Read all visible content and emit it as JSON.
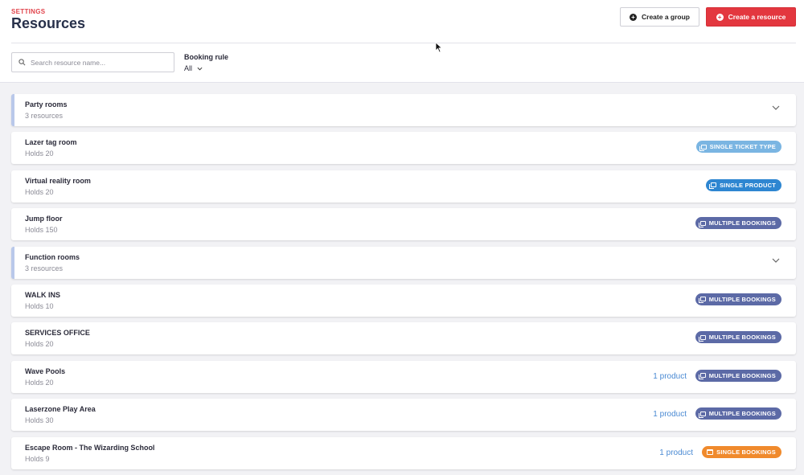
{
  "header": {
    "section_label": "SETTINGS",
    "title": "Resources",
    "create_group_label": "Create a group",
    "create_resource_label": "Create a resource"
  },
  "filters": {
    "search_placeholder": "Search resource name...",
    "search_value": "",
    "booking_rule_label": "Booking rule",
    "booking_rule_value": "All"
  },
  "colors": {
    "accent_red": "#e3373f",
    "badge_single_ticket": "#7ab5e2",
    "badge_single_product": "#2e86d1",
    "badge_multiple": "#5c6aa6",
    "badge_single_bookings": "#f08a2c",
    "link_blue": "#4a8ad3"
  },
  "rows": [
    {
      "type": "group",
      "name": "Party rooms",
      "sub": "3 resources"
    },
    {
      "type": "item",
      "name": "Lazer tag room",
      "sub": "Holds 20",
      "badge": "SINGLE TICKET TYPE",
      "badge_icon": "stack-icon",
      "badge_color": "#7ab5e2",
      "link": ""
    },
    {
      "type": "item",
      "name": "Virtual reality room",
      "sub": "Holds 20",
      "badge": "SINGLE PRODUCT",
      "badge_icon": "stack-icon",
      "badge_color": "#2e86d1",
      "link": ""
    },
    {
      "type": "item",
      "name": "Jump floor",
      "sub": "Holds 150",
      "badge": "MULTIPLE BOOKINGS",
      "badge_icon": "stack-icon",
      "badge_color": "#5c6aa6",
      "link": ""
    },
    {
      "type": "group",
      "name": "Function rooms",
      "sub": "3 resources"
    },
    {
      "type": "item",
      "name": "WALK INS",
      "sub": "Holds 10",
      "badge": "MULTIPLE BOOKINGS",
      "badge_icon": "stack-icon",
      "badge_color": "#5c6aa6",
      "link": ""
    },
    {
      "type": "item",
      "name": "SERVICES OFFICE",
      "sub": "Holds 20",
      "badge": "MULTIPLE BOOKINGS",
      "badge_icon": "stack-icon",
      "badge_color": "#5c6aa6",
      "link": ""
    },
    {
      "type": "item",
      "name": "Wave Pools",
      "sub": "Holds 20",
      "badge": "MULTIPLE BOOKINGS",
      "badge_icon": "stack-icon",
      "badge_color": "#5c6aa6",
      "link": "1 product"
    },
    {
      "type": "item",
      "name": "Laserzone Play Area",
      "sub": "Holds 30",
      "badge": "MULTIPLE BOOKINGS",
      "badge_icon": "stack-icon",
      "badge_color": "#5c6aa6",
      "link": "1 product"
    },
    {
      "type": "item",
      "name": "Escape Room - The Wizarding School",
      "sub": "Holds 9",
      "badge": "SINGLE BOOKINGS",
      "badge_icon": "calendar-icon",
      "badge_color": "#f08a2c",
      "link": "1 product"
    }
  ]
}
